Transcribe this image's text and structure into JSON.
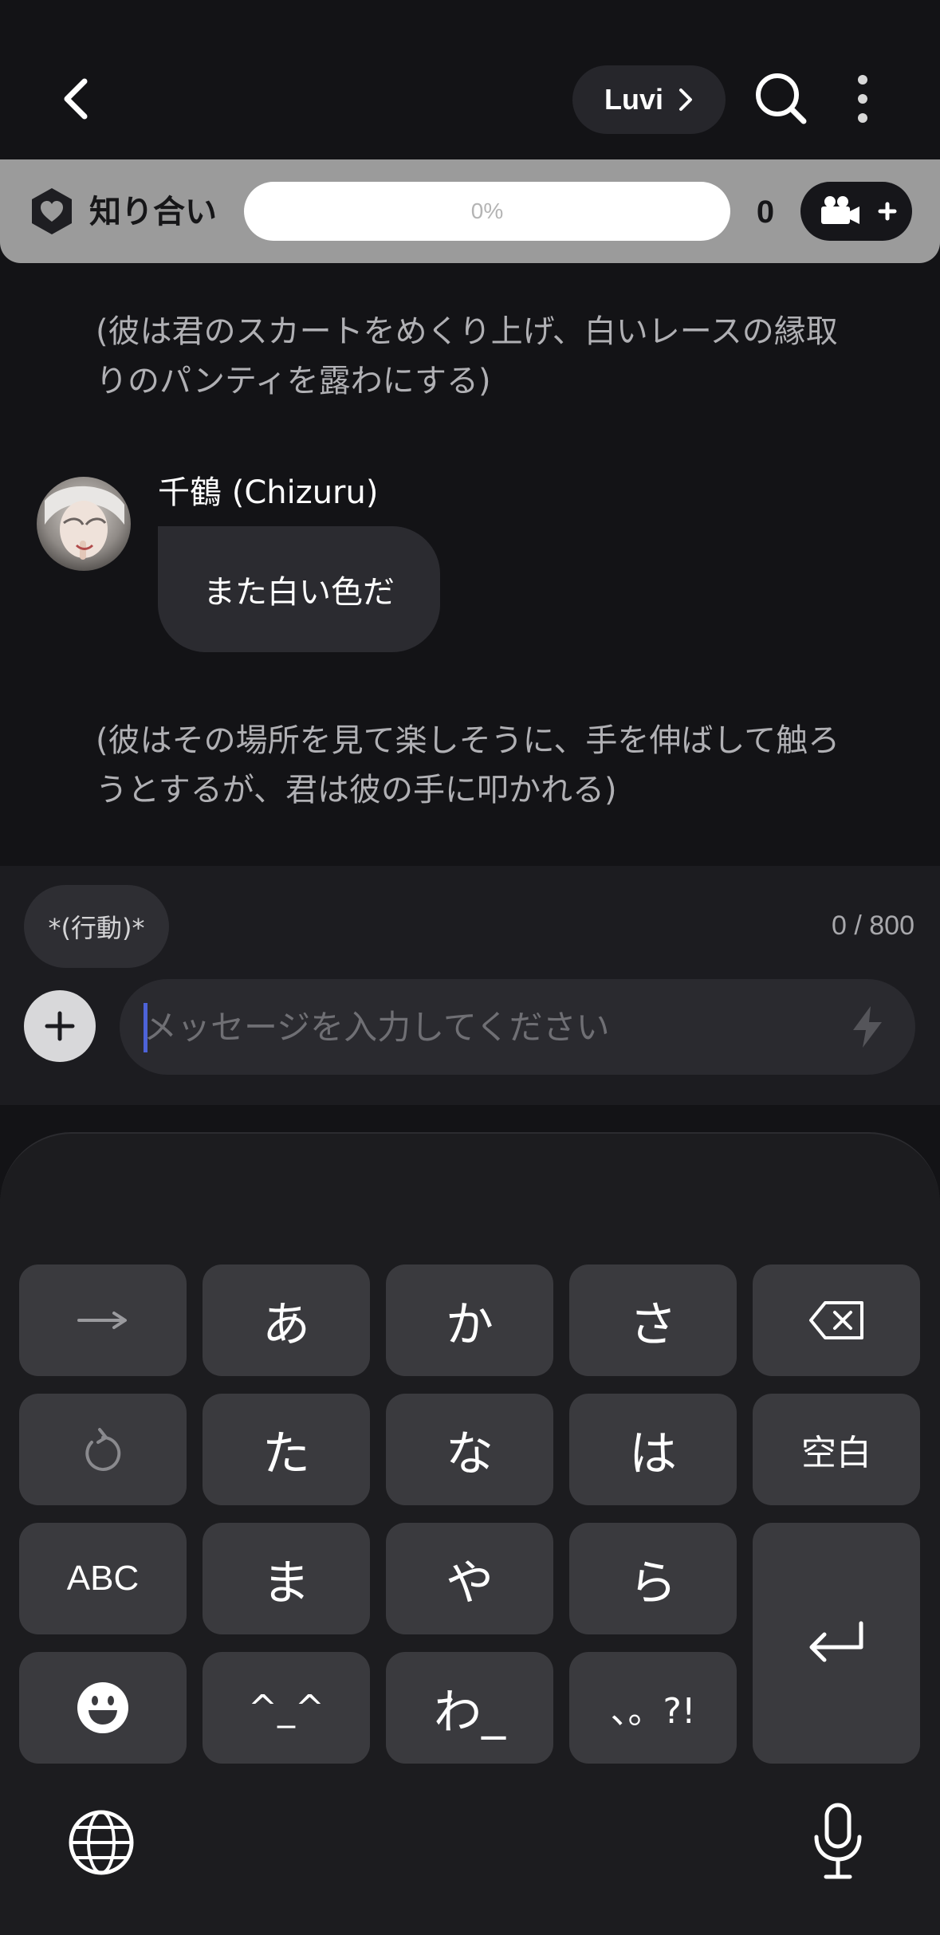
{
  "header": {
    "back_icon": "chevron-left-icon",
    "luvi_label": "Luvi",
    "search_icon": "search-icon",
    "more_icon": "more-vertical-icon"
  },
  "relationship": {
    "icon": "heart-shield-icon",
    "label": "知り合い",
    "progress_text": "0%",
    "progress_fraction": 0,
    "count": "0",
    "camera_icon": "video-camera-plus-icon"
  },
  "chat": {
    "narration_1": "(彼は君のスカートをめくり上げ、白いレースの縁取りのパンティを露わにする)",
    "character_name": "千鶴 (Chizuru)",
    "message_1": "また白い色だ",
    "narration_2": "(彼はその場所を見て楽しそうに、手を伸ばして触ろうとするが、君は彼の手に叩かれる)"
  },
  "composer": {
    "action_chip": "*(行動)*",
    "char_count": "0 / 800",
    "placeholder": "メッセージを入力してください",
    "value": ""
  },
  "keyboard": {
    "row1": [
      "→",
      "あ",
      "か",
      "さ",
      "⌫"
    ],
    "row2": [
      "↺",
      "た",
      "な",
      "は",
      "空白"
    ],
    "row3": [
      "ABC",
      "ま",
      "や",
      "ら"
    ],
    "row4": [
      "☺",
      "^_^",
      "わ_",
      "、。?!"
    ],
    "enter_icon": "enter-icon",
    "globe_icon": "globe-icon",
    "mic_icon": "microphone-icon"
  },
  "colors": {
    "background": "#131316",
    "relationship_bar": "#9b9b9b",
    "bubble": "#2b2b30",
    "key": "#3a3a3e",
    "caret": "#4d63d8"
  }
}
